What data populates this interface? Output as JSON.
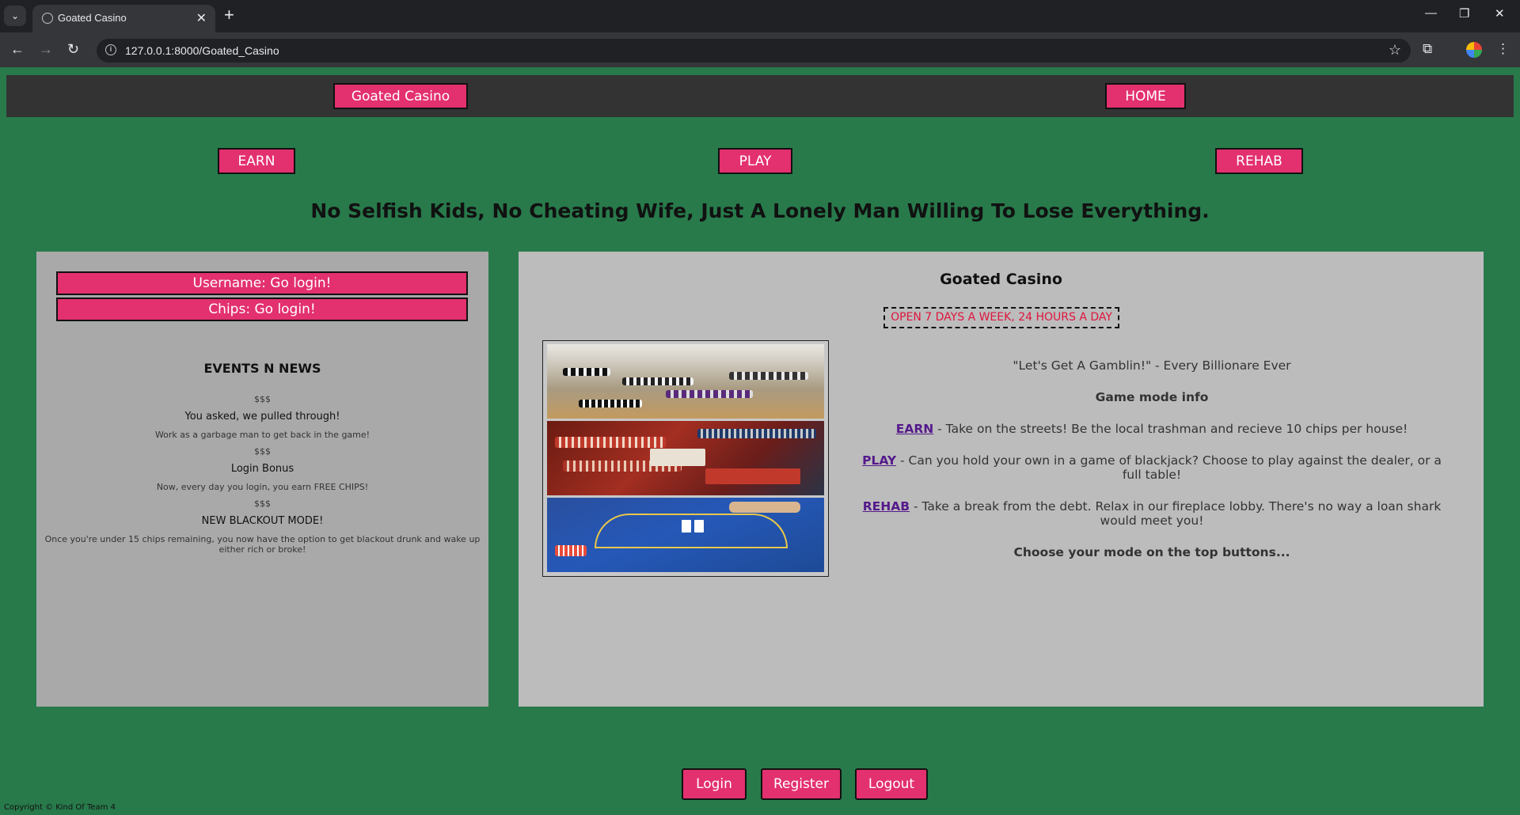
{
  "browser": {
    "tab_title": "Goated Casino",
    "url": "127.0.0.1:8000/Goated_Casino",
    "new_tab": "+",
    "tab_close": "✕"
  },
  "header": {
    "brand": "Goated Casino",
    "home": "HOME"
  },
  "nav": {
    "earn": "EARN",
    "play": "PLAY",
    "rehab": "REHAB"
  },
  "tagline": "No Selfish Kids, No Cheating Wife, Just A Lonely Man Willing To Lose Everything.",
  "sidebar": {
    "username": "Username: Go login!",
    "chips": "Chips: Go login!",
    "events_title": "EVENTS N NEWS",
    "events": [
      {
        "sep": "$$$",
        "head": "You asked, we pulled through!",
        "body": "Work as a garbage man to get back in the game!"
      },
      {
        "sep": "$$$",
        "head": "Login Bonus",
        "body": "Now, every day you login, you earn FREE CHIPS!"
      },
      {
        "sep": "$$$",
        "head": "NEW BLACKOUT MODE!",
        "body": "Once you're under 15 chips remaining, you now have the option to get blackout drunk and wake up either rich or broke!"
      }
    ]
  },
  "main": {
    "title": "Goated Casino",
    "hours": "OPEN 7 DAYS A WEEK, 24 HOURS A DAY",
    "quote": "\"Let's Get A Gamblin!\" - Every Billionare Ever",
    "info_title": "Game mode info",
    "earn_link": "EARN",
    "earn_desc": " - Take on the streets! Be the local trashman and recieve 10 chips per house!",
    "play_link": "PLAY",
    "play_desc": " - Can you hold your own in a game of blackjack? Choose to play against the dealer, or a full table!",
    "rehab_link": "REHAB",
    "rehab_desc": " - Take a break from the debt. Relax in our fireplace lobby. There's no way a loan shark would meet you!",
    "cta": "Choose your mode on the top buttons..."
  },
  "footer": {
    "login": "Login",
    "register": "Register",
    "logout": "Logout",
    "copyright": "Copyright © Kind Of Team 4"
  },
  "colors": {
    "page_bg": "#287a4b",
    "accent": "#e3306f",
    "header_bg": "#333333",
    "sidebar_bg": "#a9a9a9",
    "main_bg": "#bcbcbc",
    "hours_text": "#e0143c"
  }
}
